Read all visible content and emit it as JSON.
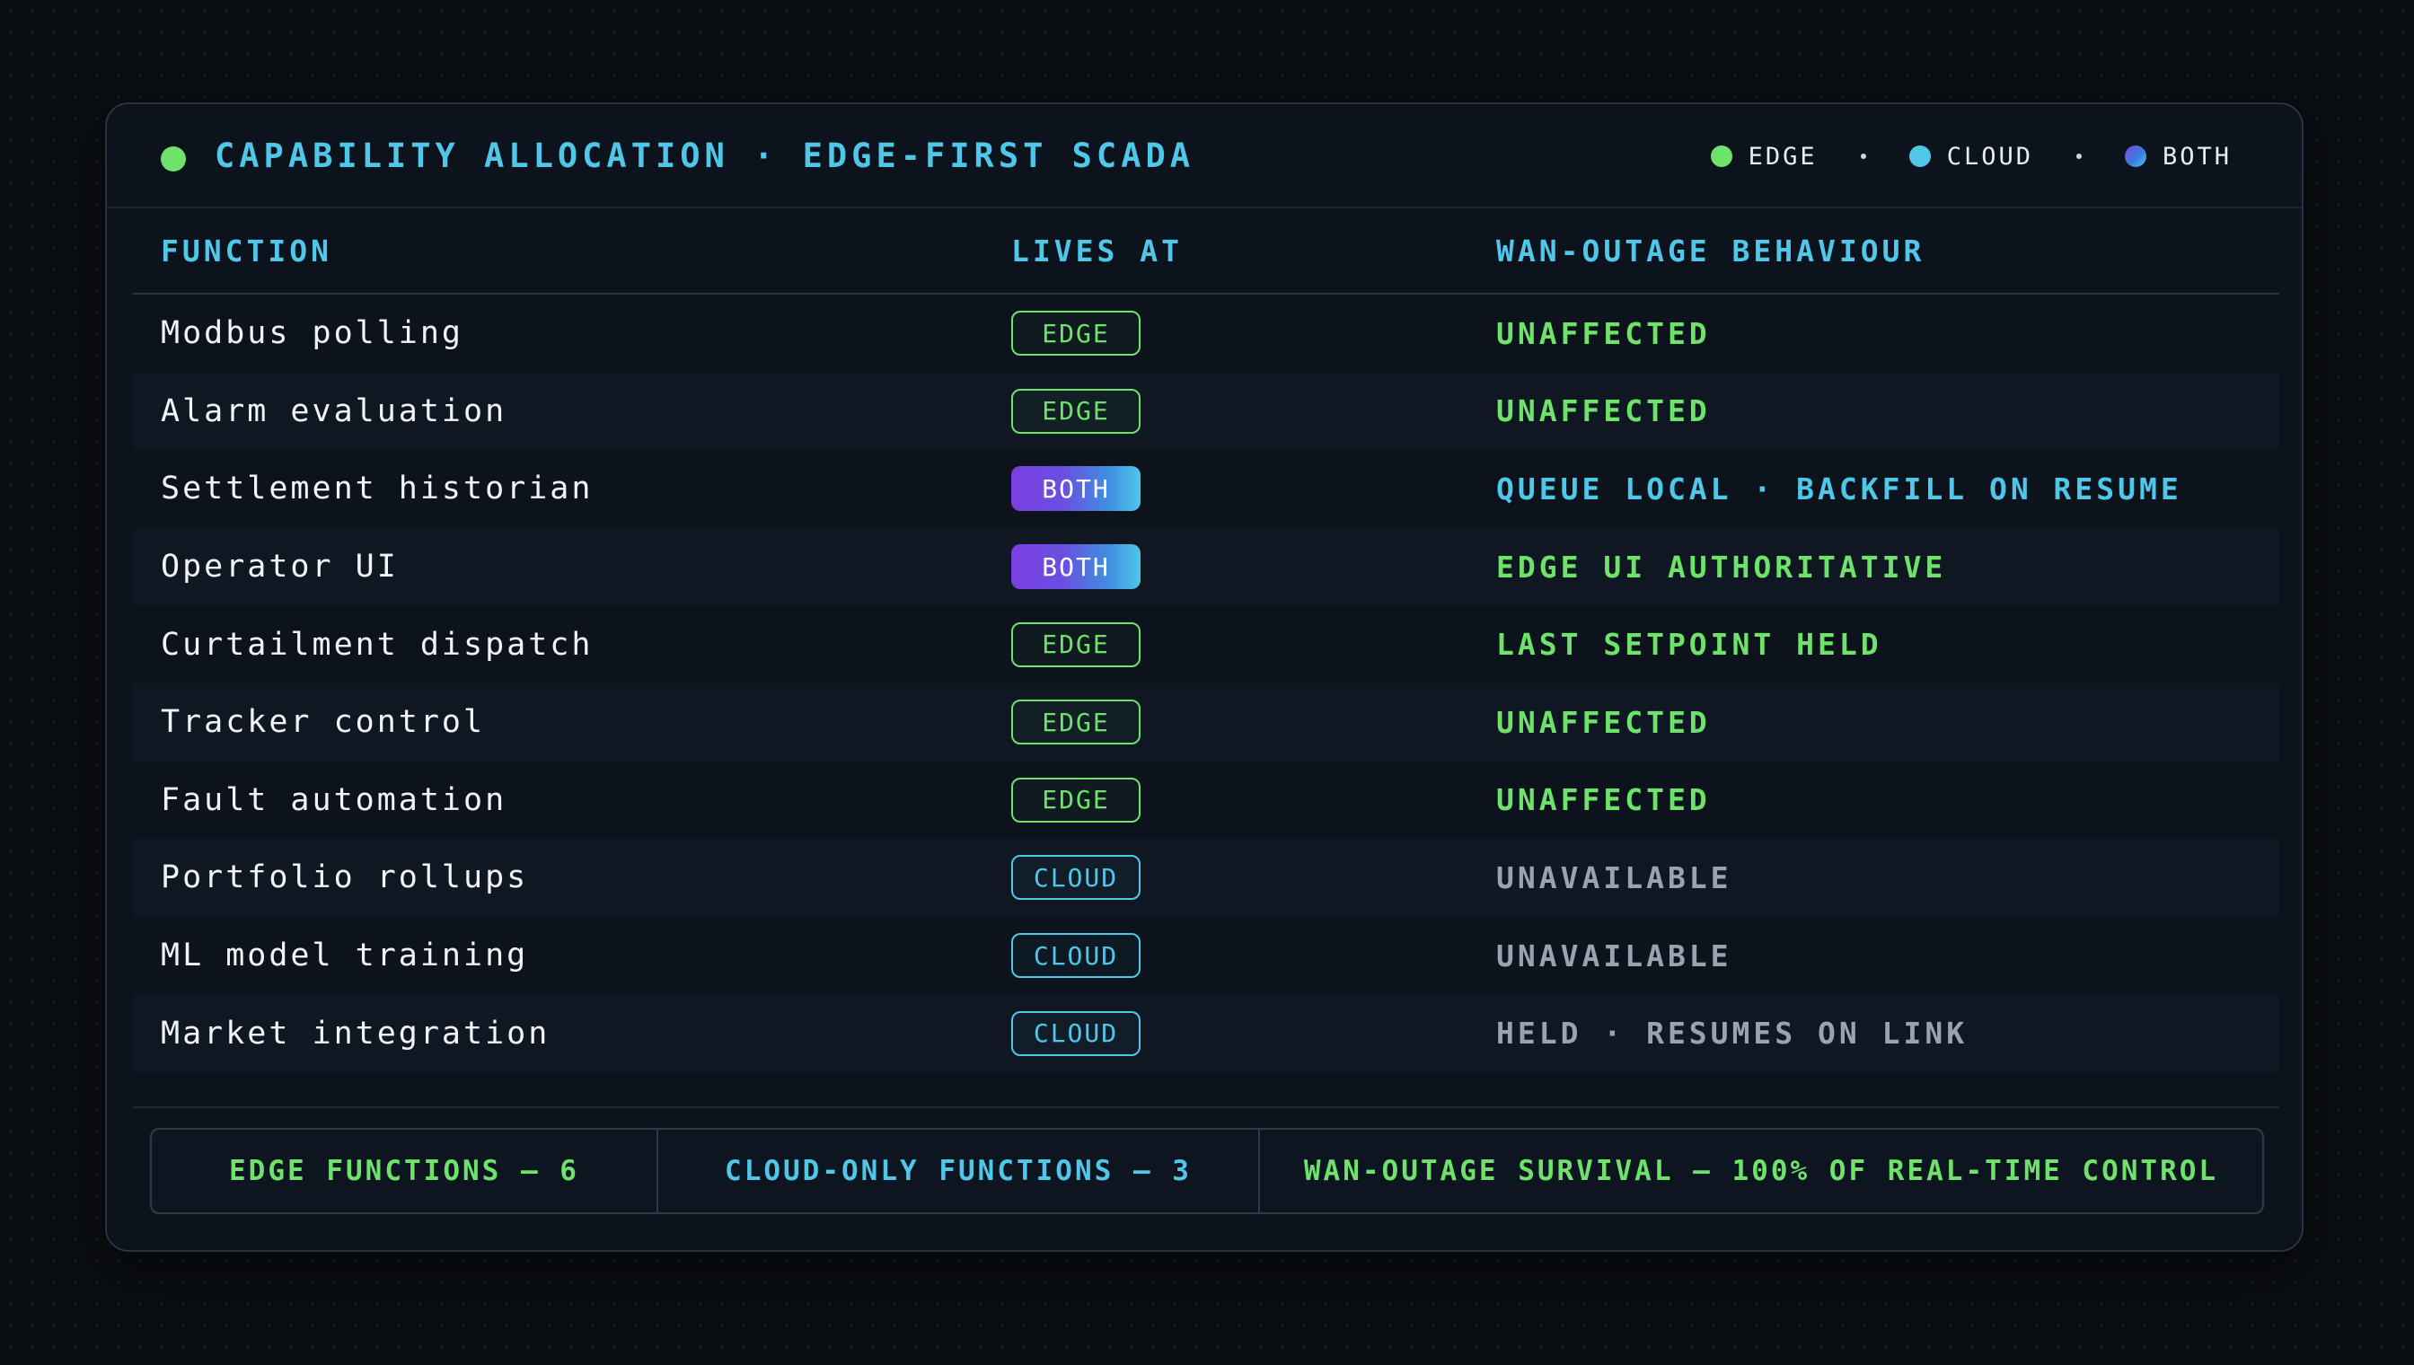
{
  "header": {
    "title": "CAPABILITY ALLOCATION · EDGE-FIRST SCADA",
    "legend": [
      {
        "key": "edge",
        "label": "EDGE",
        "color": "#6ee26b"
      },
      {
        "key": "cloud",
        "label": "CLOUD",
        "color": "#4fc7e8"
      },
      {
        "key": "both",
        "label": "BOTH",
        "color": "#7a3fe0"
      }
    ]
  },
  "table": {
    "columns": [
      "FUNCTION",
      "LIVES AT",
      "WAN-OUTAGE BEHAVIOUR"
    ],
    "rows": [
      {
        "function": "Modbus polling",
        "lives_at": "EDGE",
        "kind": "edge",
        "behaviour": "UNAFFECTED",
        "tone": "green"
      },
      {
        "function": "Alarm evaluation",
        "lives_at": "EDGE",
        "kind": "edge",
        "behaviour": "UNAFFECTED",
        "tone": "green"
      },
      {
        "function": "Settlement historian",
        "lives_at": "BOTH",
        "kind": "both",
        "behaviour": "QUEUE LOCAL · BACKFILL ON RESUME",
        "tone": "cyan"
      },
      {
        "function": "Operator UI",
        "lives_at": "BOTH",
        "kind": "both",
        "behaviour": "EDGE UI AUTHORITATIVE",
        "tone": "green"
      },
      {
        "function": "Curtailment dispatch",
        "lives_at": "EDGE",
        "kind": "edge",
        "behaviour": "LAST SETPOINT HELD",
        "tone": "green"
      },
      {
        "function": "Tracker control",
        "lives_at": "EDGE",
        "kind": "edge",
        "behaviour": "UNAFFECTED",
        "tone": "green"
      },
      {
        "function": "Fault automation",
        "lives_at": "EDGE",
        "kind": "edge",
        "behaviour": "UNAFFECTED",
        "tone": "green"
      },
      {
        "function": "Portfolio rollups",
        "lives_at": "CLOUD",
        "kind": "cloud",
        "behaviour": "UNAVAILABLE",
        "tone": "gray"
      },
      {
        "function": "ML model training",
        "lives_at": "CLOUD",
        "kind": "cloud",
        "behaviour": "UNAVAILABLE",
        "tone": "gray"
      },
      {
        "function": "Market integration",
        "lives_at": "CLOUD",
        "kind": "cloud",
        "behaviour": "HELD · RESUMES ON LINK",
        "tone": "gray"
      }
    ]
  },
  "summary": {
    "edge": "EDGE FUNCTIONS — 6",
    "cloud": "CLOUD-ONLY FUNCTIONS — 3",
    "survival": "WAN-OUTAGE SURVIVAL — 100% OF REAL-TIME CONTROL"
  },
  "colors": {
    "edge": "#6ee26b",
    "cloud": "#4fc7e8",
    "background": "#0a0d12",
    "panel": "#0c131c"
  }
}
